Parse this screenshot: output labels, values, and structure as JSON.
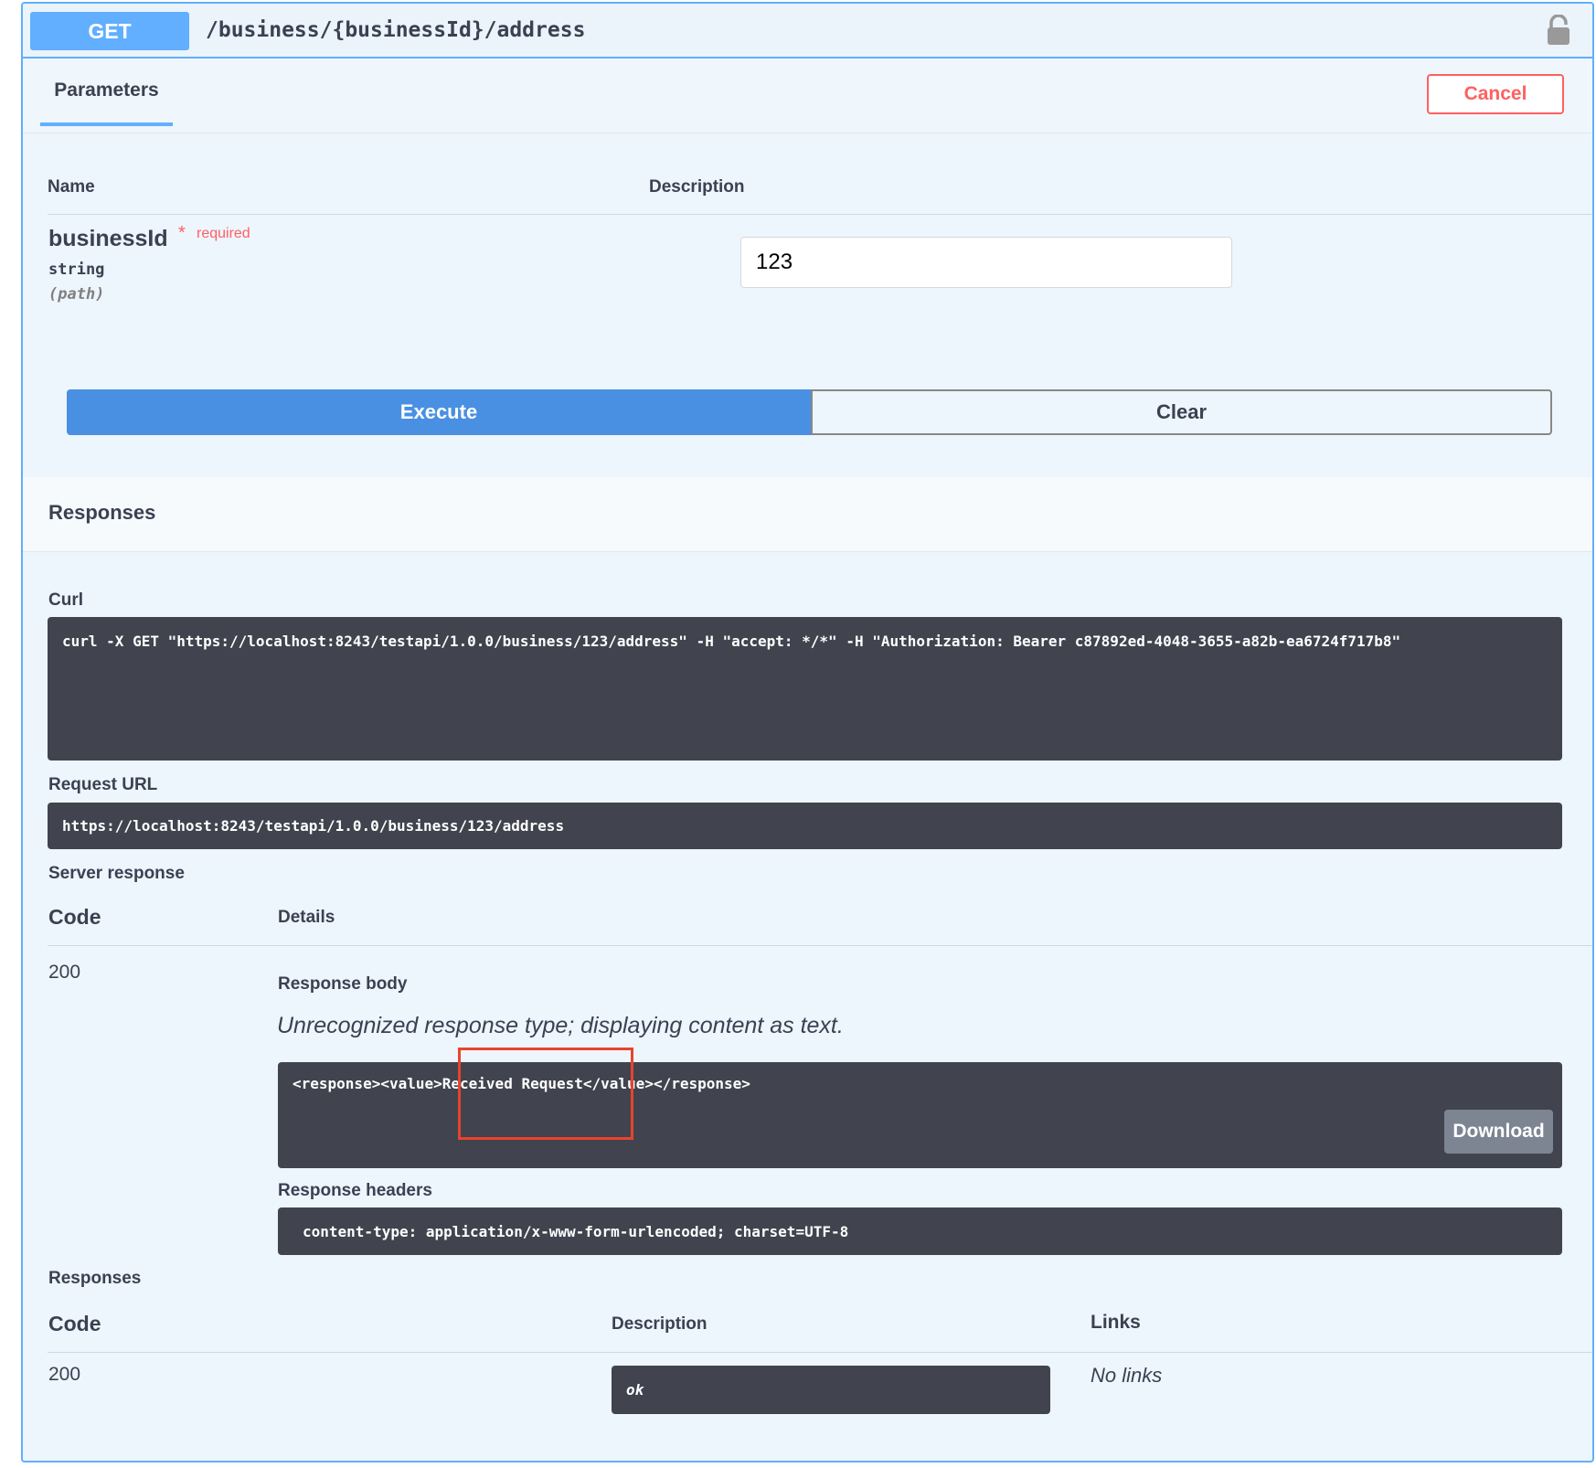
{
  "operation": {
    "method": "GET",
    "path": "/business/{businessId}/address"
  },
  "parameters": {
    "tab_label": "Parameters",
    "cancel_label": "Cancel",
    "col_name": "Name",
    "col_description": "Description",
    "param": {
      "name": "businessId",
      "required_star": "*",
      "required_label": "required",
      "type": "string",
      "in": "(path)",
      "value": "123"
    }
  },
  "actions": {
    "execute_label": "Execute",
    "clear_label": "Clear"
  },
  "responses_section": {
    "title": "Responses",
    "curl_label": "Curl",
    "curl_command": "curl -X GET \"https://localhost:8243/testapi/1.0.0/business/123/address\" -H \"accept: */*\" -H \"Authorization: Bearer c87892ed-4048-3655-a82b-ea6724f717b8\"",
    "request_url_label": "Request URL",
    "request_url": "https://localhost:8243/testapi/1.0.0/business/123/address",
    "server_response_label": "Server response",
    "code_header": "Code",
    "details_header": "Details",
    "code": "200",
    "response_body_label": "Response body",
    "unrecognized_note": "Unrecognized response type; displaying content as text.",
    "response_body": "<response><value>Received Request</value></response>",
    "download_label": "Download",
    "response_headers_label": "Response headers",
    "response_headers": "content-type: application/x-www-form-urlencoded; charset=UTF-8"
  },
  "documented_responses": {
    "title": "Responses",
    "code_header": "Code",
    "description_header": "Description",
    "links_header": "Links",
    "rows": [
      {
        "code": "200",
        "description": "ok",
        "links": "No links"
      }
    ]
  },
  "colors": {
    "get_accent": "#61affe",
    "execute": "#4990e2",
    "cancel": "#ff6060",
    "code_background": "#41444e",
    "highlight_box": "#e8432d"
  },
  "icons": {
    "lock": "lock-icon"
  }
}
